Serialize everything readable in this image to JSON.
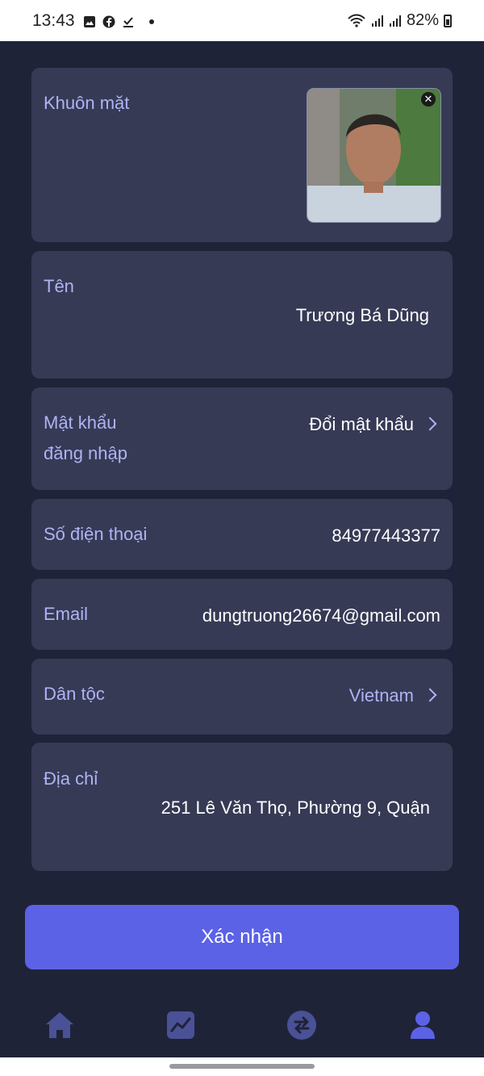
{
  "status_bar": {
    "time": "13:43",
    "battery": "82%"
  },
  "profile": {
    "face_label": "Khuôn mặt",
    "name_label": "Tên",
    "name_value": "Trương Bá Dũng",
    "password_label_line1": "Mật khẩu",
    "password_label_line2": "đăng nhập",
    "password_action": "Đổi mật khẩu",
    "phone_label": "Số điện thoại",
    "phone_value": "84977443377",
    "email_label": "Email",
    "email_value": "dungtruong26674@gmail.com",
    "ethnicity_label": "Dân tộc",
    "ethnicity_value": "Vietnam",
    "address_label": "Địa chỉ",
    "address_value": "251 Lê Văn Thọ, Phường 9, Quận"
  },
  "confirm_label": "Xác nhận",
  "colors": {
    "background": "#1f2338",
    "card": "#363a55",
    "label": "#aeb4f3",
    "accent": "#5b62e6",
    "nav_inactive": "#4a5196",
    "nav_active": "#5b62e6"
  },
  "nav": {
    "items": [
      {
        "icon": "home-icon"
      },
      {
        "icon": "chart-icon"
      },
      {
        "icon": "exchange-icon"
      },
      {
        "icon": "user-icon"
      }
    ]
  }
}
